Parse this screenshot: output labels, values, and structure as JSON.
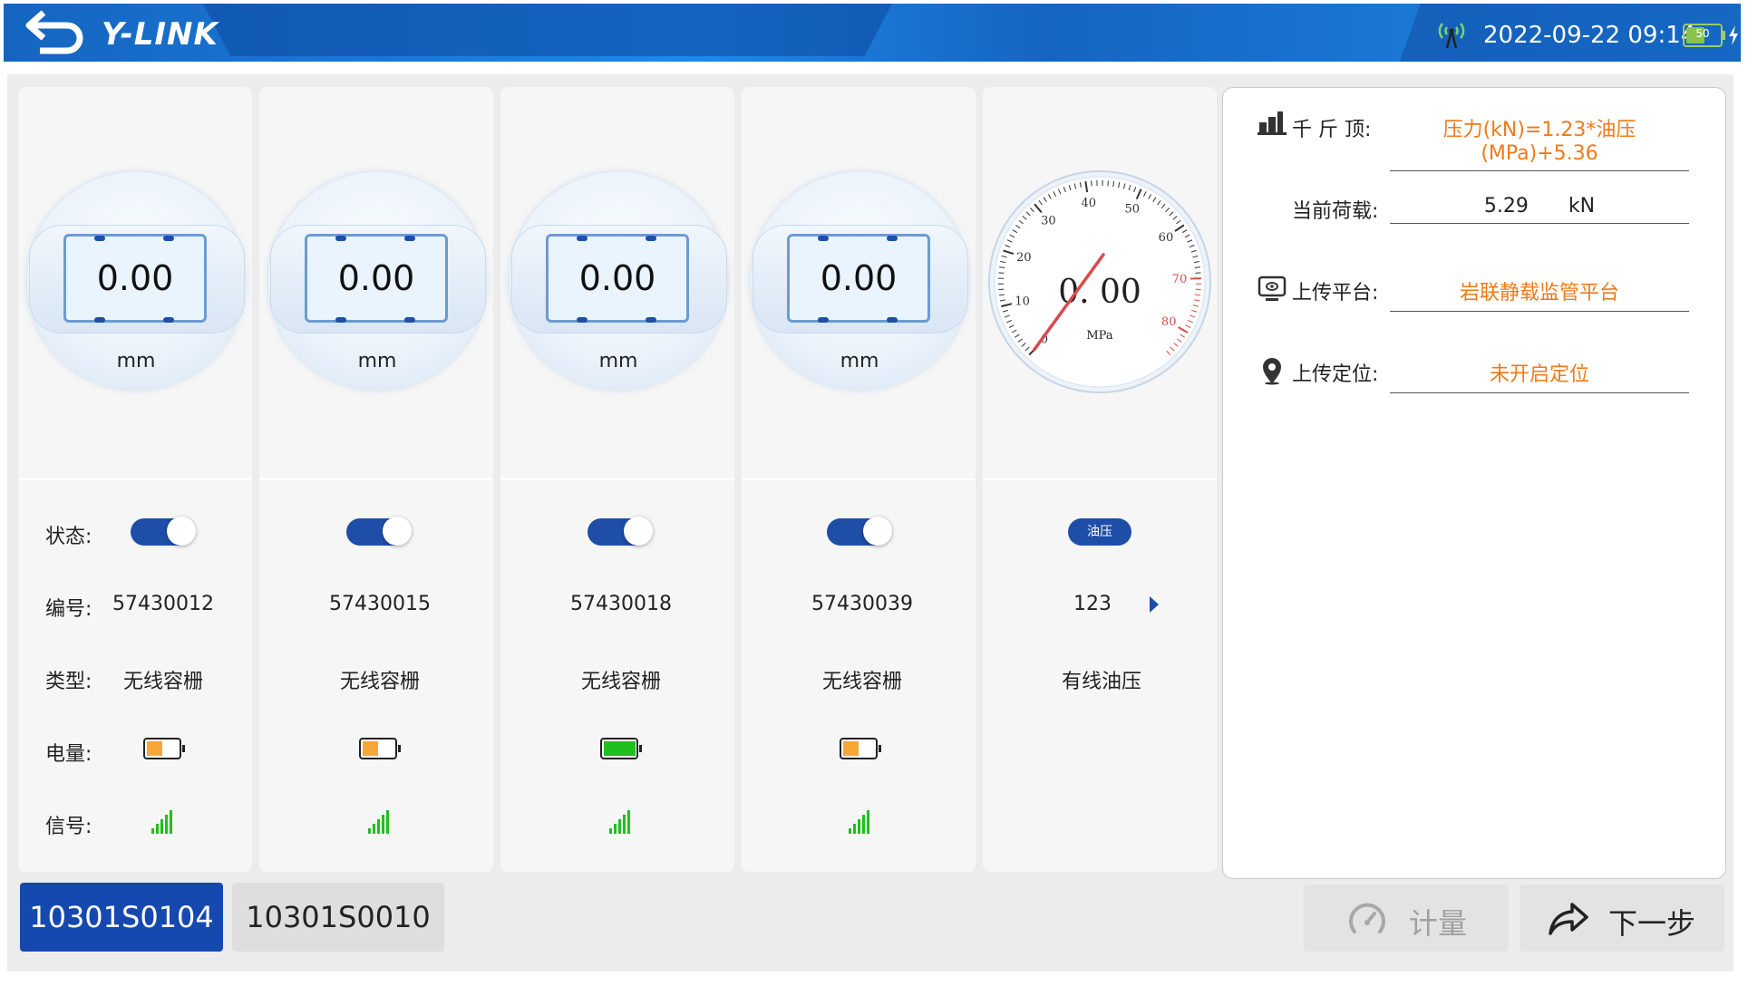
{
  "header": {
    "logo": "Y-LINK",
    "datetime": "2022-09-22  09:14",
    "battery_level": "50",
    "colors": {
      "primary": "#1976d2",
      "dark": "#0d47a1"
    }
  },
  "row_labels": {
    "status": "状态:",
    "number": "编号:",
    "type": "类型:",
    "battery": "电量:",
    "signal": "信号:"
  },
  "sensors": [
    {
      "value": "0.00",
      "unit": "mm",
      "status_on": true,
      "number": "57430012",
      "type": "无线容栅",
      "battery_pct": 45,
      "battery_color": "#f7a736",
      "signal_icon": "signal-bars-icon"
    },
    {
      "value": "0.00",
      "unit": "mm",
      "status_on": true,
      "number": "57430015",
      "type": "无线容栅",
      "battery_pct": 45,
      "battery_color": "#f7a736",
      "signal_icon": "signal-bars-icon"
    },
    {
      "value": "0.00",
      "unit": "mm",
      "status_on": true,
      "number": "57430018",
      "type": "无线容栅",
      "battery_pct": 100,
      "battery_color": "#1fbf1f",
      "signal_icon": "signal-bars-icon"
    },
    {
      "value": "0.00",
      "unit": "mm",
      "status_on": true,
      "number": "57430039",
      "type": "无线容栅",
      "battery_pct": 45,
      "battery_color": "#f7a736",
      "signal_icon": "signal-bars-icon"
    }
  ],
  "pressure": {
    "value": "0. 00",
    "unit": "MPa",
    "badge": "油压",
    "number": "123",
    "type": "有线油压",
    "ticks": [
      "10",
      "20",
      "30",
      "40",
      "50",
      "60",
      "70",
      "80"
    ],
    "zero": "0",
    "needle_value": 0
  },
  "panel": {
    "jack_label": "千 斤 顶:",
    "jack_formula": "压力(kN)=1.23*油压(MPa)+5.36",
    "load_label": "当前荷载:",
    "load_value": "5.29",
    "load_unit": "kN",
    "platform_label": "上传平台:",
    "platform_value": "岩联静载监管平台",
    "location_label": "上传定位:",
    "location_value": "未开启定位"
  },
  "tabs": [
    {
      "label": "10301S0104",
      "active": true
    },
    {
      "label": "10301S0010",
      "active": false
    }
  ],
  "buttons": {
    "measure": "计量",
    "next": "下一步"
  }
}
